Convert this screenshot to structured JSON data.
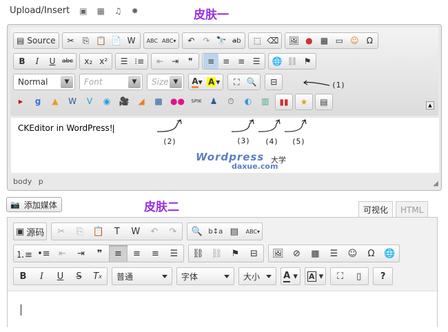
{
  "top": {
    "upload_label": "Upload/Insert",
    "skin1_label": "皮肤一",
    "icons": [
      "image-icon",
      "video-icon",
      "audio-icon",
      "media-icon"
    ]
  },
  "ed1": {
    "row1": {
      "source_label": "Source",
      "groups": [
        [
          "cut-icon",
          "copy-icon",
          "paste-icon",
          "paste-text-icon",
          "paste-word-icon"
        ],
        [
          "spellcheck-icon",
          "spellcheck-dropdown-icon"
        ],
        [
          "undo-icon",
          "redo-icon",
          "find-icon",
          "replace-icon"
        ],
        [
          "select-all-icon",
          "remove-format-icon"
        ],
        [
          "image-icon",
          "flash-icon",
          "table-icon",
          "hr-icon",
          "smiley-icon",
          "special-char-icon"
        ]
      ]
    },
    "row2": {
      "groups": [
        [
          "B",
          "I",
          "U",
          "abc"
        ],
        [
          "x₂",
          "x²"
        ],
        [
          "numbered-list-icon",
          "bullet-list-icon"
        ],
        [
          "outdent-icon",
          "indent-icon",
          "❞"
        ],
        [
          "align-left-icon",
          "align-center-icon",
          "align-right-icon",
          "justify-icon"
        ],
        [
          "link-icon",
          "unlink-icon",
          "anchor-icon"
        ]
      ]
    },
    "row3": {
      "format_value": "Normal",
      "font_placeholder": "Font",
      "size_placeholder": "Size",
      "text_color": "A",
      "bg_color": "A"
    },
    "content_text": "CKEditor in WordPress!",
    "status_path": "body p",
    "watermark": {
      "brand": "Wordpress",
      "cn": "大学",
      "domain": "daxue.com"
    }
  },
  "annotations": [
    "(1)",
    "(2)",
    "(3)",
    "(4)",
    "(5)"
  ],
  "skin2_label": "皮肤二",
  "ed2": {
    "media_button": "添加媒体",
    "tabs": [
      "可视化",
      "HTML"
    ],
    "row1": {
      "source_label": "源码"
    },
    "row3": {
      "format_value": "普通",
      "font_value": "字体",
      "size_value": "大小"
    }
  },
  "colors": {
    "accent": "#9b30e0",
    "selected_button": "#bcd4ee"
  }
}
